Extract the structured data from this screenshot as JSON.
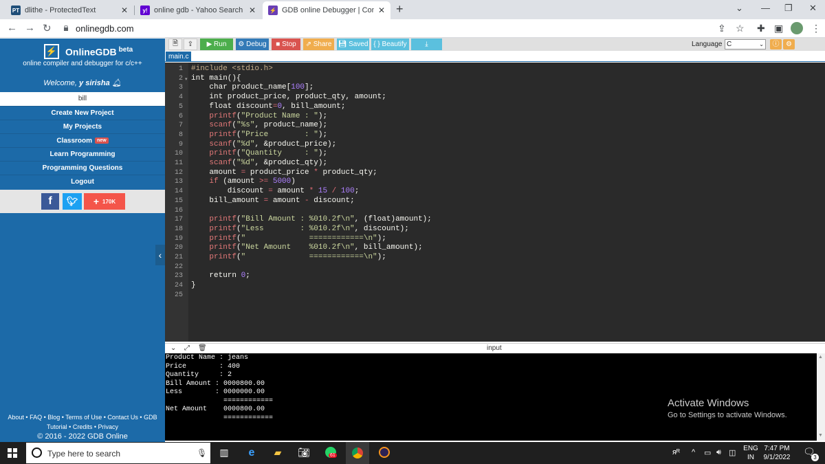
{
  "browser": {
    "tabs": [
      {
        "title": "dlithe - ProtectedText",
        "favicon": "PT",
        "active": false
      },
      {
        "title": "online gdb - Yahoo Search Result",
        "favicon": "y!",
        "active": false
      },
      {
        "title": "GDB online Debugger | Compiler",
        "favicon": "bolt",
        "active": true
      }
    ],
    "url": "onlinegdb.com"
  },
  "sidebar": {
    "brand_name": "OnlineGDB",
    "brand_beta": "beta",
    "brand_sub": "online compiler and debugger for c/c++",
    "welcome_prefix": "Welcome, ",
    "welcome_user": "y sirisha",
    "user_item": "bill",
    "links": [
      {
        "label": "Create New Project"
      },
      {
        "label": "My Projects"
      },
      {
        "label": "Classroom",
        "badge": "new"
      },
      {
        "label": "Learn Programming"
      },
      {
        "label": "Programming Questions"
      },
      {
        "label": "Logout"
      }
    ],
    "social": {
      "plus_count": "170K"
    },
    "footer": {
      "line1": "About • FAQ • Blog • Terms of Use • Contact Us • GDB",
      "line2": "Tutorial • Credits • Privacy",
      "line3": "© 2016 - 2022 GDB Online"
    }
  },
  "toolbar": {
    "run": "Run",
    "debug": "Debug",
    "stop": "Stop",
    "share": "Share",
    "saved": "Saved",
    "beautify": "{ } Beautify",
    "language_label": "Language",
    "language_value": "C"
  },
  "file_tab": "main.c",
  "editor": {
    "lines": [
      "#include <stdio.h>",
      "int main(){",
      "    char product_name[100];",
      "    int product_price, product_qty, amount;",
      "    float discount=0, bill_amount;",
      "    printf(\"Product Name : \");",
      "    scanf(\"%s\", product_name);",
      "    printf(\"Price        : \");",
      "    scanf(\"%d\", &product_price);",
      "    printf(\"Quantity     : \");",
      "    scanf(\"%d\", &product_qty);",
      "    amount = product_price * product_qty;",
      "    if (amount >= 5000)",
      "        discount = amount * 15 / 100;",
      "    bill_amount = amount - discount;",
      "",
      "    printf(\"Bill Amount : %010.2f\\n\", (float)amount);",
      "    printf(\"Less        : %010.2f\\n\", discount);",
      "    printf(\"              ============\\n\");",
      "    printf(\"Net Amount    %010.2f\\n\", bill_amount);",
      "    printf(\"              ============\\n\");",
      "",
      "    return 0;",
      "}",
      ""
    ]
  },
  "io": {
    "label": "input",
    "output": [
      "Product Name : jeans",
      "Price        : 400",
      "Quantity     : 2",
      "Bill Amount : 0000800.00",
      "Less        : 0000000.00",
      "              ============",
      "Net Amount    0000800.00",
      "              ============"
    ]
  },
  "watermark": {
    "title": "Activate Windows",
    "sub": "Go to Settings to activate Windows."
  },
  "taskbar": {
    "search_placeholder": "Type here to search",
    "whatsapp_badge": "61",
    "lang": "ENG",
    "region": "IN",
    "time": "7:47 PM",
    "date": "9/1/2022",
    "notifications": "3"
  }
}
